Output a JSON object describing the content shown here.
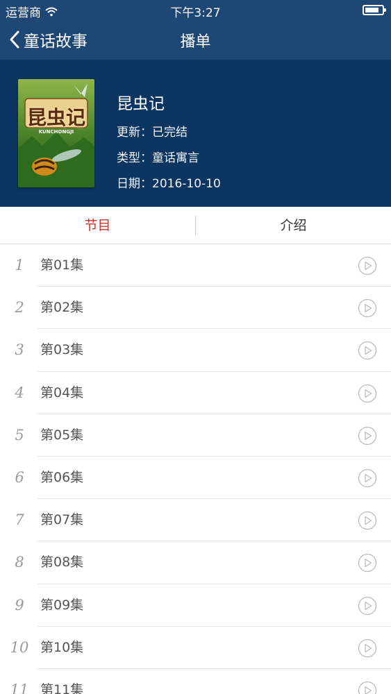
{
  "status_bar": {
    "carrier": "运营商",
    "time": "下午3:27"
  },
  "nav": {
    "back_label": "童话故事",
    "title": "播单"
  },
  "album": {
    "name": "昆虫记",
    "update": "更新：已完结",
    "type": "类型：童话寓言",
    "date": "日期：2016-10-10",
    "cover_title": "昆虫记",
    "cover_subtitle": "KUNCHONGJI"
  },
  "tabs": {
    "episodes": "节目",
    "intro": "介绍"
  },
  "episodes": [
    {
      "num": "1",
      "title": "第01集"
    },
    {
      "num": "2",
      "title": "第02集"
    },
    {
      "num": "3",
      "title": "第03集"
    },
    {
      "num": "4",
      "title": "第04集"
    },
    {
      "num": "5",
      "title": "第05集"
    },
    {
      "num": "6",
      "title": "第06集"
    },
    {
      "num": "7",
      "title": "第07集"
    },
    {
      "num": "8",
      "title": "第08集"
    },
    {
      "num": "9",
      "title": "第09集"
    },
    {
      "num": "10",
      "title": "第10集"
    },
    {
      "num": "11",
      "title": "第11集"
    }
  ],
  "colors": {
    "nav_bg": "#1e4775",
    "header_bg": "#0d3561",
    "active_tab": "#d0302a",
    "play_icon": "#bbbbbb"
  },
  "icons": {
    "back": "chevron-left-icon",
    "wifi": "wifi-icon",
    "battery": "battery-icon",
    "play": "play-circle-icon"
  }
}
